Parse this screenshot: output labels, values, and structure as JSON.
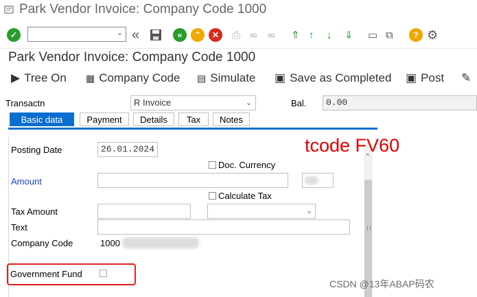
{
  "window": {
    "title": "Park Vendor Invoice: Company Code 1000"
  },
  "page": {
    "title": "Park Vendor Invoice: Company Code 1000"
  },
  "app_toolbar": {
    "tree_on": "Tree On",
    "company_code": "Company Code",
    "simulate": "Simulate",
    "save_as_completed": "Save as Completed",
    "post": "Post"
  },
  "header": {
    "transaction_label": "Transactn",
    "transaction_value": "R Invoice",
    "balance_label": "Bal.",
    "balance_value": "0.00"
  },
  "tabs": [
    "Basic data",
    "Payment",
    "Details",
    "Tax",
    "Notes"
  ],
  "form": {
    "posting_date_label": "Posting Date",
    "posting_date_value": "26.01.2024",
    "doc_currency_label": "Doc. Currency",
    "amount_label": "Amount",
    "calculate_tax_label": "Calculate Tax",
    "tax_amount_label": "Tax Amount",
    "text_label": "Text",
    "company_code_label": "Company Code",
    "company_code_value": "1000",
    "government_fund_label": "Government Fund"
  },
  "annotation": "tcode FV60",
  "watermark": "CSDN @13年ABAP码农",
  "colors": {
    "accent": "#0a6ed1",
    "annotation": "#e00000",
    "amount_label": "#1a3fd6"
  }
}
